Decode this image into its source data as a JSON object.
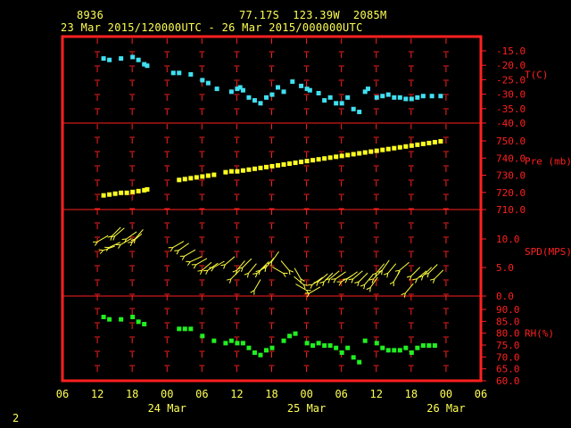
{
  "header": {
    "station": "8936",
    "location": "77.17S  123.39W  2085M",
    "period": "23 Mar 2015/120000UTC - 26 Mar 2015/000000UTC"
  },
  "page_number": "2",
  "colors": {
    "frame": "#ff2020",
    "grid": "#ff2020",
    "text": "#ffff54",
    "temperature": "#40e0f0",
    "pressure": "#ffff20",
    "wind": "#ffff40",
    "humidity": "#20f020"
  },
  "chart_data": {
    "type": "scatter",
    "x_axis": {
      "unit": "hours since 23 Mar 2015 06 UTC",
      "range": [
        0,
        72
      ],
      "tick_labels": [
        "06",
        "12",
        "18",
        "00",
        "06",
        "12",
        "18",
        "00",
        "06",
        "12",
        "18",
        "00",
        "06"
      ],
      "tick_hours": [
        0,
        6,
        12,
        18,
        24,
        30,
        36,
        42,
        48,
        54,
        60,
        66,
        72
      ],
      "date_labels": [
        {
          "label": "24 Mar",
          "hour": 18
        },
        {
          "label": "25 Mar",
          "hour": 42
        },
        {
          "label": "26 Mar",
          "hour": 66
        }
      ]
    },
    "panels": [
      {
        "name": "T(C)",
        "ylim": [
          -40,
          -15
        ],
        "ticks": [
          "-15.0",
          "-20.0",
          "-25.0",
          "-30.0",
          "-35.0",
          "-40.0"
        ],
        "tick_values": [
          -15,
          -20,
          -25,
          -30,
          -35,
          -40
        ],
        "values": [
          [
            7,
            -17.5
          ],
          [
            8,
            -18
          ],
          [
            10,
            -17.5
          ],
          [
            12,
            -17
          ],
          [
            13,
            -18
          ],
          [
            14,
            -19.5
          ],
          [
            14.5,
            -20
          ],
          [
            19,
            -22.5
          ],
          [
            20,
            -22.5
          ],
          [
            22,
            -23
          ],
          [
            24,
            -25
          ],
          [
            25,
            -26
          ],
          [
            26.5,
            -28
          ],
          [
            29,
            -29
          ],
          [
            30,
            -28
          ],
          [
            30.5,
            -27.5
          ],
          [
            31,
            -28.5
          ],
          [
            32,
            -31
          ],
          [
            33,
            -32
          ],
          [
            34,
            -33
          ],
          [
            35,
            -31
          ],
          [
            36,
            -30
          ],
          [
            37,
            -27.5
          ],
          [
            38,
            -29
          ],
          [
            39.5,
            -25.5
          ],
          [
            41,
            -27
          ],
          [
            42,
            -28
          ],
          [
            42.5,
            -28.5
          ],
          [
            44,
            -29.5
          ],
          [
            45,
            -32
          ],
          [
            46,
            -31
          ],
          [
            47,
            -33
          ],
          [
            48,
            -33
          ],
          [
            49,
            -31
          ],
          [
            50,
            -35
          ],
          [
            51,
            -36
          ],
          [
            52,
            -29
          ],
          [
            52.5,
            -28
          ],
          [
            54,
            -31
          ],
          [
            55,
            -30.5
          ],
          [
            56,
            -30
          ],
          [
            57,
            -31
          ],
          [
            58,
            -31
          ],
          [
            59,
            -31.5
          ],
          [
            60,
            -31.5
          ],
          [
            61,
            -31
          ],
          [
            62,
            -30.5
          ],
          [
            63.5,
            -30.5
          ],
          [
            65,
            -30.5
          ]
        ]
      },
      {
        "name": "Pre (mb)",
        "ylim": [
          710,
          750
        ],
        "ticks": [
          "750.0",
          "740.0",
          "730.0",
          "720.0",
          "710.0"
        ],
        "tick_values": [
          750,
          740,
          730,
          720,
          710
        ],
        "values": [
          [
            7,
            718.5
          ],
          [
            8,
            719
          ],
          [
            9,
            719.5
          ],
          [
            10,
            720
          ],
          [
            11,
            720
          ],
          [
            12,
            720.5
          ],
          [
            13,
            721
          ],
          [
            14,
            721.5
          ],
          [
            14.5,
            722
          ],
          [
            20,
            727.5
          ],
          [
            21,
            728
          ],
          [
            22,
            728.5
          ],
          [
            23,
            729
          ],
          [
            24,
            729.5
          ],
          [
            25,
            730
          ],
          [
            26,
            730.5
          ],
          [
            28,
            732
          ],
          [
            29,
            732.5
          ],
          [
            30,
            732.5
          ],
          [
            31,
            733
          ],
          [
            32,
            733.5
          ],
          [
            33,
            734
          ],
          [
            34,
            734.5
          ],
          [
            35,
            735
          ],
          [
            36,
            735.5
          ],
          [
            37,
            736
          ],
          [
            38,
            736.5
          ],
          [
            39,
            737
          ],
          [
            40,
            737.5
          ],
          [
            41,
            738
          ],
          [
            42,
            738.5
          ],
          [
            43,
            739
          ],
          [
            44,
            739.5
          ],
          [
            45,
            740
          ],
          [
            46,
            740.5
          ],
          [
            47,
            741
          ],
          [
            48,
            741.5
          ],
          [
            49,
            742
          ],
          [
            50,
            742.5
          ],
          [
            51,
            743
          ],
          [
            52,
            743.5
          ],
          [
            53,
            744
          ],
          [
            54,
            744.5
          ],
          [
            55,
            745
          ],
          [
            56,
            745.5
          ],
          [
            57,
            746
          ],
          [
            58,
            746.5
          ],
          [
            59,
            747
          ],
          [
            60,
            747.5
          ],
          [
            61,
            748
          ],
          [
            62,
            748.5
          ],
          [
            63,
            749
          ],
          [
            64,
            749.5
          ],
          [
            65,
            750
          ]
        ]
      },
      {
        "name": "SPD(MPS)",
        "ylim": [
          0,
          10
        ],
        "ticks": [
          "10.0",
          "5.0",
          "0.0"
        ],
        "tick_values": [
          10,
          5,
          0
        ],
        "values": [
          [
            6,
            9.5
          ],
          [
            7,
            8
          ],
          [
            8,
            8.5
          ],
          [
            8.5,
            10.5
          ],
          [
            9,
            10.5
          ],
          [
            10,
            9
          ],
          [
            11,
            10
          ],
          [
            12,
            9.5
          ],
          [
            12.5,
            10
          ],
          [
            19,
            8.5
          ],
          [
            20,
            8
          ],
          [
            21,
            7
          ],
          [
            22,
            6
          ],
          [
            23,
            5.5
          ],
          [
            24,
            4.5
          ],
          [
            25,
            4.5
          ],
          [
            26,
            5
          ],
          [
            28,
            5.5
          ],
          [
            29,
            3
          ],
          [
            30,
            4.5
          ],
          [
            31,
            5
          ],
          [
            32,
            4
          ],
          [
            33,
            1
          ],
          [
            33.5,
            4
          ],
          [
            34,
            4.5
          ],
          [
            35,
            5
          ],
          [
            36,
            6
          ],
          [
            38,
            4
          ],
          [
            39,
            4.5
          ],
          [
            41,
            3
          ],
          [
            41.5,
            2
          ],
          [
            42,
            1
          ],
          [
            42.5,
            0.5
          ],
          [
            43,
            2
          ],
          [
            44,
            2.5
          ],
          [
            45,
            2.5
          ],
          [
            46,
            3
          ],
          [
            47,
            3
          ],
          [
            48,
            2.5
          ],
          [
            49,
            3
          ],
          [
            50,
            3
          ],
          [
            51,
            2.5
          ],
          [
            52,
            2
          ],
          [
            53,
            1.5
          ],
          [
            53.5,
            3
          ],
          [
            54,
            4
          ],
          [
            55,
            4.5
          ],
          [
            56,
            4
          ],
          [
            57,
            2.5
          ],
          [
            58,
            4.5
          ],
          [
            59,
            0.5
          ],
          [
            60,
            3.5
          ],
          [
            61,
            3
          ],
          [
            62,
            3.5
          ],
          [
            63,
            4
          ],
          [
            64,
            3
          ]
        ],
        "wind_dirs_deg": [
          60,
          70,
          65,
          45,
          50,
          60,
          55,
          50,
          40,
          60,
          55,
          60,
          65,
          60,
          50,
          55,
          60,
          50,
          45,
          40,
          45,
          40,
          30,
          50,
          45,
          40,
          35,
          300,
          320,
          330,
          310,
          300,
          60,
          55,
          50,
          45,
          50,
          55,
          60,
          55,
          50,
          45,
          40,
          35,
          45,
          40,
          35,
          40,
          30,
          50,
          40,
          45,
          50,
          45
        ]
      },
      {
        "name": "RH(%)",
        "ylim": [
          60,
          90
        ],
        "ticks": [
          "90.0",
          "85.0",
          "80.0",
          "75.0",
          "70.0",
          "65.0",
          "60.0"
        ],
        "tick_values": [
          90,
          85,
          80,
          75,
          70,
          65,
          60
        ],
        "values": [
          [
            7,
            87
          ],
          [
            8,
            86
          ],
          [
            10,
            86
          ],
          [
            12,
            87
          ],
          [
            13,
            85
          ],
          [
            14,
            84
          ],
          [
            20,
            82
          ],
          [
            21,
            82
          ],
          [
            22,
            82
          ],
          [
            24,
            79
          ],
          [
            26,
            77
          ],
          [
            28,
            76
          ],
          [
            29,
            77
          ],
          [
            30,
            76
          ],
          [
            31,
            76
          ],
          [
            32,
            74
          ],
          [
            33,
            72
          ],
          [
            34,
            71
          ],
          [
            35,
            73
          ],
          [
            36,
            74
          ],
          [
            38,
            77
          ],
          [
            39,
            79
          ],
          [
            40,
            80
          ],
          [
            42,
            76
          ],
          [
            43,
            75
          ],
          [
            44,
            76
          ],
          [
            45,
            75
          ],
          [
            46,
            75
          ],
          [
            47,
            74
          ],
          [
            48,
            72
          ],
          [
            49,
            74
          ],
          [
            50,
            70
          ],
          [
            51,
            68
          ],
          [
            52,
            77
          ],
          [
            54,
            76
          ],
          [
            55,
            74
          ],
          [
            56,
            73
          ],
          [
            57,
            73
          ],
          [
            58,
            73
          ],
          [
            59,
            74
          ],
          [
            60,
            72
          ],
          [
            61,
            74
          ],
          [
            62,
            75
          ],
          [
            63,
            75
          ],
          [
            64,
            75
          ]
        ]
      }
    ]
  }
}
